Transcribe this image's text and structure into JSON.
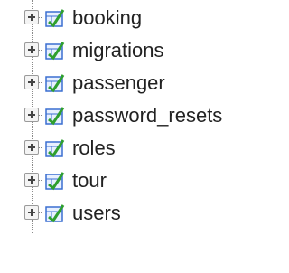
{
  "tree": {
    "items": [
      {
        "label": "booking"
      },
      {
        "label": "migrations"
      },
      {
        "label": "passenger"
      },
      {
        "label": "password_resets"
      },
      {
        "label": "roles"
      },
      {
        "label": "tour"
      },
      {
        "label": "users"
      }
    ]
  },
  "icons": {
    "expander": "plus-box-icon",
    "table": "table-structure-icon"
  },
  "colors": {
    "icon_border": "#3a6fd1",
    "icon_check": "#2f9f2f",
    "text": "#222222",
    "tree_line": "#8a8a8a"
  }
}
